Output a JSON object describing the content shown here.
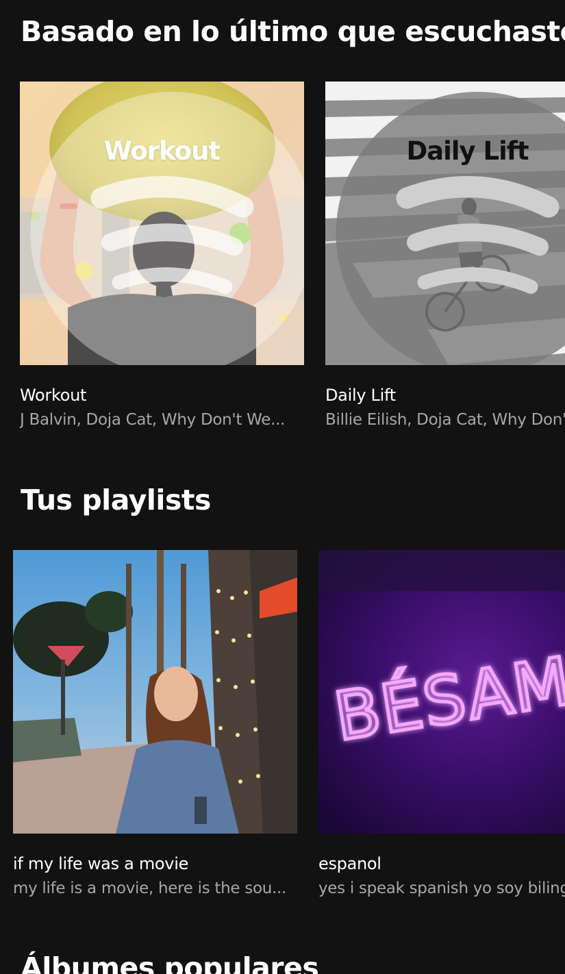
{
  "sections": [
    {
      "title": "Basado en lo último que escuchaste",
      "cards": [
        {
          "title": "Workout",
          "subtitle": "J Balvin, Doja Cat, Why Don't We...",
          "cover_text": "Workout"
        },
        {
          "title": "Daily Lift",
          "subtitle": "Billie Eilish, Doja Cat, Why Don't We",
          "cover_text": "Daily Lift"
        }
      ]
    },
    {
      "title": "Tus playlists",
      "cards": [
        {
          "title": "if my life was a movie",
          "subtitle": "my life is a movie, here is the sou...",
          "cover_text": ""
        },
        {
          "title": "espanol",
          "subtitle": "yes i speak spanish yo soy bilingue",
          "cover_text": "BÉSAME"
        }
      ]
    },
    {
      "title": "Álbumes populares"
    }
  ],
  "icons": {
    "spotify": "spotify-logo-icon"
  },
  "colors": {
    "background": "#121212",
    "text_primary": "#ffffff",
    "text_secondary": "#a7a7a7",
    "neon": "#e35cff"
  }
}
